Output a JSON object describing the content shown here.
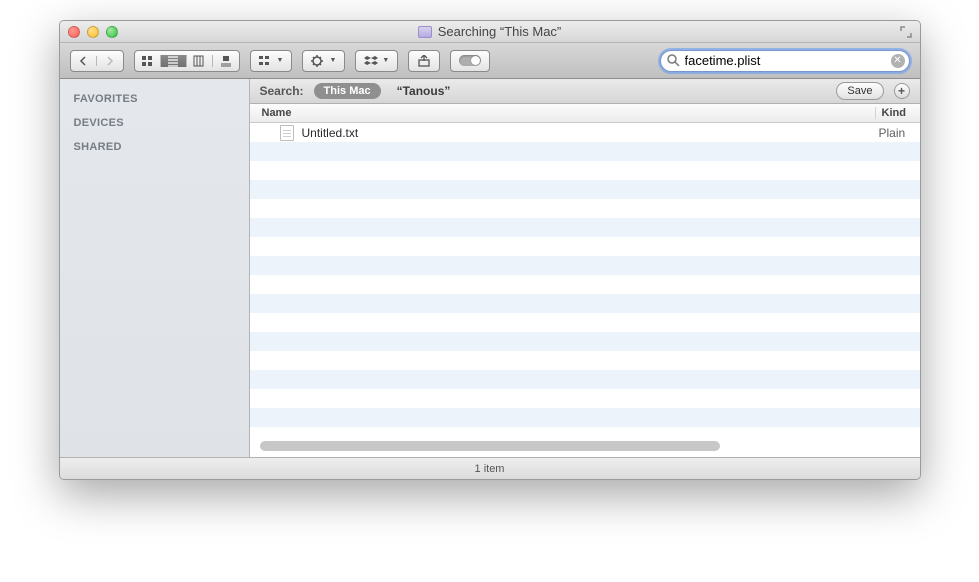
{
  "window": {
    "title": "Searching “This Mac”"
  },
  "search": {
    "value": "facetime.plist"
  },
  "sidebar": {
    "sections": [
      {
        "label": "FAVORITES"
      },
      {
        "label": "DEVICES"
      },
      {
        "label": "SHARED"
      }
    ]
  },
  "scope": {
    "label": "Search:",
    "active": "This Mac",
    "other": "“Tanous”",
    "save": "Save"
  },
  "columns": {
    "name": "Name",
    "kind": "Kind"
  },
  "files": [
    {
      "name": "Untitled.txt",
      "kind": "Plain"
    }
  ],
  "status": {
    "text": "1 item"
  }
}
